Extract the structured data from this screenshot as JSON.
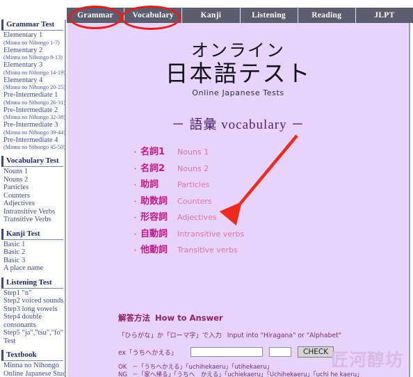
{
  "tabs": [
    {
      "label": "Grammar",
      "circled": true
    },
    {
      "label": "Vocabulary",
      "circled": true
    },
    {
      "label": "Kanji",
      "circled": false
    },
    {
      "label": "Listening",
      "circled": false
    },
    {
      "label": "Reading",
      "circled": false
    },
    {
      "label": "JLPT",
      "circled": false
    }
  ],
  "sidebar": {
    "sections": [
      {
        "heading": "Grammar Test",
        "items": [
          {
            "label": "Elementary 1",
            "sub": "(Minna no Nihongo 1-7)"
          },
          {
            "label": "Elementary 2",
            "sub": "(Minna no Nihongo 8-13)"
          },
          {
            "label": "Elementary 3",
            "sub": "(Minna no Nihongo 14-19)"
          },
          {
            "label": "Elementary 4",
            "sub": "(Minna no Nihongo 20-25)"
          },
          {
            "label": "Pre-Intermediate 1",
            "sub": "(Minna no Nihongo 26-31)"
          },
          {
            "label": "Pre-Intermediate 2",
            "sub": "(Minna no Nihongo 32-38)"
          },
          {
            "label": "Pre-Intermediate 3",
            "sub": "(Minna no Nihongo 39-44)"
          },
          {
            "label": "Pre-Intermediate 4",
            "sub": "(Minna no Nihongo 45-50)"
          }
        ]
      },
      {
        "heading": "Vocabulary Test",
        "items": [
          {
            "label": "Nouns 1",
            "sub": ""
          },
          {
            "label": "Nouns 2",
            "sub": ""
          },
          {
            "label": "Particles",
            "sub": ""
          },
          {
            "label": "Counters",
            "sub": ""
          },
          {
            "label": "Adjectives",
            "sub": ""
          },
          {
            "label": "Intransitive Verbs",
            "sub": ""
          },
          {
            "label": "Transitive Verbs",
            "sub": ""
          }
        ]
      },
      {
        "heading": "Kanji Test",
        "items": [
          {
            "label": "Basic 1",
            "sub": ""
          },
          {
            "label": "Basic 2",
            "sub": ""
          },
          {
            "label": "Basic 3",
            "sub": ""
          },
          {
            "label": "A place name",
            "sub": ""
          }
        ]
      },
      {
        "heading": "Listening Test",
        "items": [
          {
            "label": "Step1 \"n\"",
            "sub": ""
          },
          {
            "label": "Step2 voiced sounds",
            "sub": ""
          },
          {
            "label": "Step3 long vowels",
            "sub": ""
          },
          {
            "label": "Step4 double consonants",
            "sub": ""
          },
          {
            "label": "Step5 \"ja\",\"tsu\",\"fo\"",
            "sub": ""
          },
          {
            "label": "Test",
            "sub": ""
          }
        ]
      },
      {
        "heading": "Textbook",
        "items": [
          {
            "label": "Minna no Nihongo",
            "sub": ""
          },
          {
            "label": "Online Japanese Study",
            "sub": ""
          }
        ]
      }
    ]
  },
  "main": {
    "title_jp_line1": "オンライン",
    "title_jp_line2": "日本語テスト",
    "title_en": "Online Japanese Tests",
    "section_subtitle": "－ 語彙 vocabulary －",
    "vocab_items": [
      {
        "bullet": "・",
        "jp": "名詞1",
        "en": "Nouns 1"
      },
      {
        "bullet": "・",
        "jp": "名詞2",
        "en": "Nouns 2"
      },
      {
        "bullet": "・",
        "jp": "助詞",
        "en": "Particles"
      },
      {
        "bullet": "・",
        "jp": "助数詞",
        "en": "Counters"
      },
      {
        "bullet": "・",
        "jp": "形容詞",
        "en": "Adjectives"
      },
      {
        "bullet": "・",
        "jp": "自動詞",
        "en": "Intransitive verbs"
      },
      {
        "bullet": "・",
        "jp": "他動詞",
        "en": "Transitive verbs"
      }
    ]
  },
  "answer": {
    "heading_jp": "解答方法",
    "heading_en": "How to Answer",
    "instruction_jp": "「ひらがな」か「ローマ字」で入力",
    "instruction_en": "Input into \"Hiragana\" or \"Alphabet\"",
    "example_label": "ex「うちへかえる」",
    "input_main_value": "",
    "input_main_placeholder": "",
    "input_small_value": "",
    "input_small_placeholder": "",
    "check_label": "CHECK",
    "ok_tag": "OK",
    "ok_text": "－「うちへかえる」「uchihekaeru」「utihekaeru」",
    "ng_tag": "NG",
    "ng_text": "－「家へ帰る」「うちへ　かえる」「uchiekaeru」「Uchihekaeru」「uchi he kaeru」"
  },
  "annotations": {
    "ellipse_color": "#e81d18",
    "arrow_color": "#ed2a1e",
    "arrow_from": "425,195",
    "arrow_to": "322,315"
  },
  "watermark": {
    "text": "匠河醇坊"
  },
  "colors": {
    "tabbar_bg": "#5d5d70",
    "content_bg": "#e8d4fb",
    "sidebar_link": "#3d4a8c",
    "sidebar_heading": "#1d2a63",
    "vocab_jp": "#c71585",
    "vocab_en": "#e06fae"
  }
}
